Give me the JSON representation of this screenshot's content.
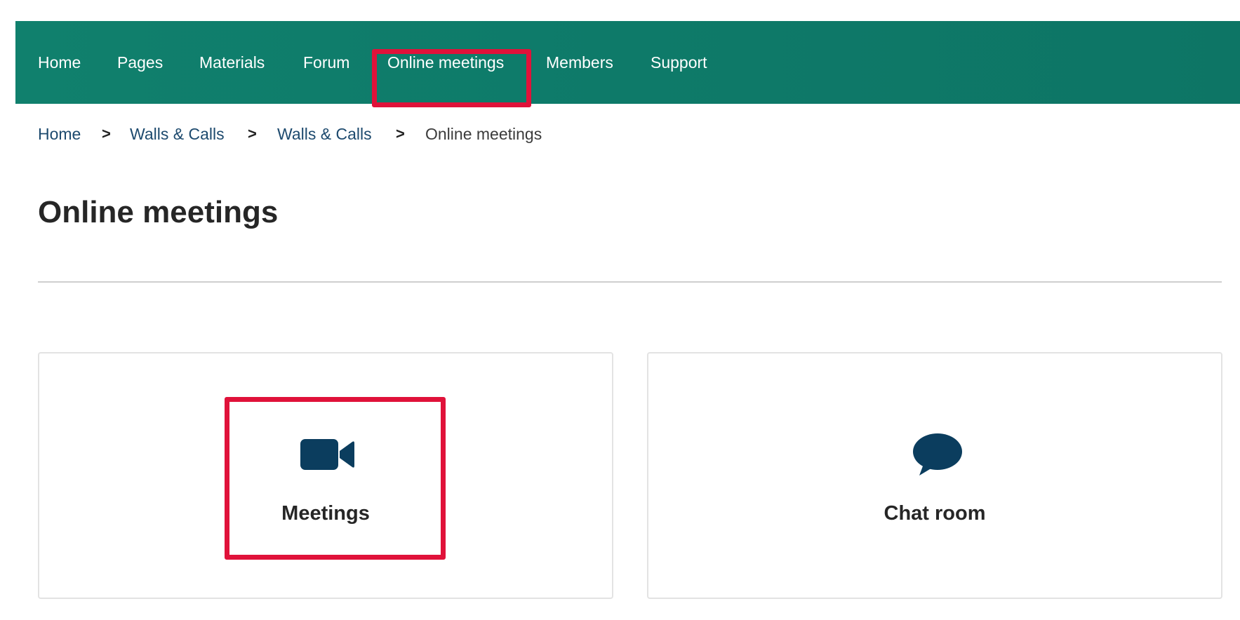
{
  "nav": {
    "items": [
      {
        "label": "Home"
      },
      {
        "label": "Pages"
      },
      {
        "label": "Materials"
      },
      {
        "label": "Forum"
      },
      {
        "label": "Online meetings",
        "highlighted": true
      },
      {
        "label": "Members"
      },
      {
        "label": "Support"
      }
    ]
  },
  "breadcrumb": {
    "items": [
      "Home",
      "Walls & Calls",
      "Walls & Calls"
    ],
    "current": "Online meetings",
    "separator": ">"
  },
  "page": {
    "title": "Online meetings"
  },
  "cards": [
    {
      "label": "Meetings",
      "icon": "video-camera-icon",
      "highlighted": true
    },
    {
      "label": "Chat room",
      "icon": "chat-bubble-icon"
    }
  ],
  "colors": {
    "nav_background": "#0e7a69",
    "highlight": "#e0123a",
    "icon": "#0b3d5e",
    "breadcrumb_link": "#1d4a6e"
  }
}
